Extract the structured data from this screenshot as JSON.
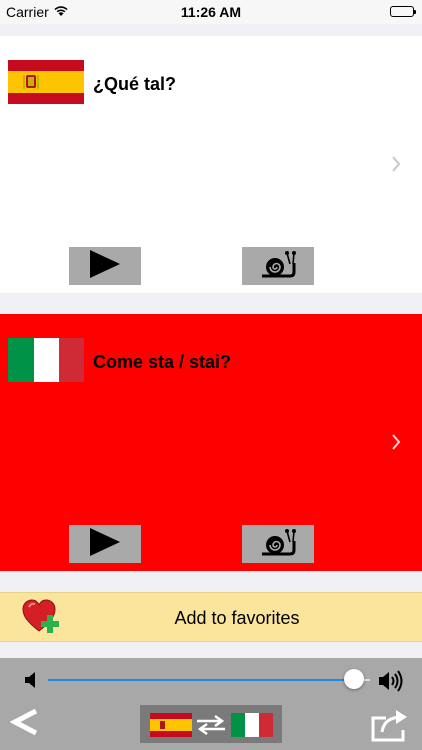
{
  "status_bar": {
    "carrier": "Carrier",
    "time": "11:26 AM"
  },
  "source": {
    "language_flag": "spain-flag",
    "phrase": "¿Qué tal?",
    "background": "#ffffff"
  },
  "target": {
    "language_flag": "italy-flag",
    "phrase": "Come sta / stai?",
    "background": "#ff0000"
  },
  "favorites": {
    "label": "Add to favorites"
  },
  "volume": {
    "level": 0.95
  },
  "icons": [
    "wifi-icon",
    "battery-icon",
    "chevron-right-icon",
    "play-icon",
    "snail-icon",
    "heart-plus-icon",
    "volume-low-icon",
    "volume-high-icon",
    "back-icon",
    "swap-languages-icon",
    "share-icon"
  ],
  "colors": {
    "accent": "#1e88e5",
    "favorites_bar": "#fbe49c",
    "control_bar": "#a8a8a8",
    "button": "#a9a9a9"
  }
}
